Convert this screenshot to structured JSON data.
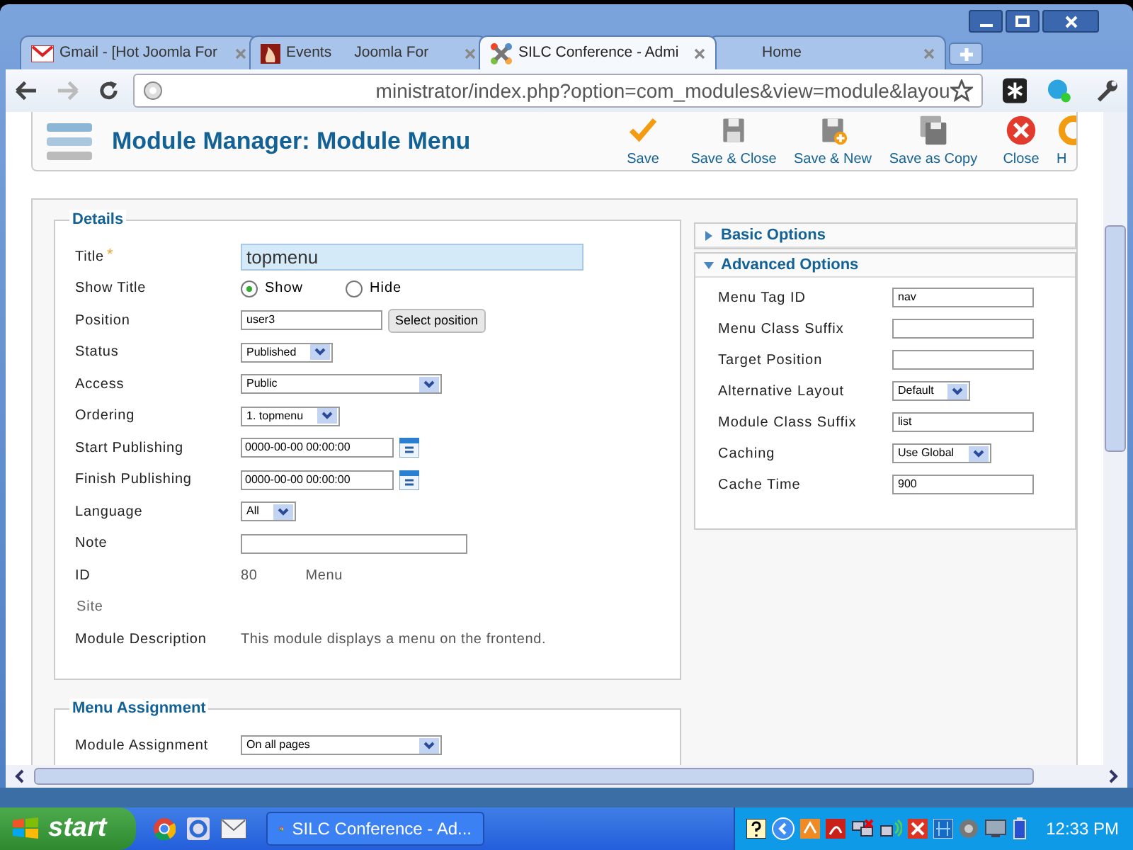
{
  "browser": {
    "tabs": [
      {
        "label": "Gmail - [Hot Joomla For",
        "kind": "gmail",
        "selected": false
      },
      {
        "label": "Events",
        "label_2": "Joomla For",
        "kind": "events",
        "selected": false
      },
      {
        "label": "SILC Conference - Admi",
        "kind": "joomla",
        "selected": true
      },
      {
        "label": "Home",
        "selected": false
      }
    ],
    "address": "ministrator/index.php?option=com_modules&view=module&layou"
  },
  "toolbar": {
    "title": "Module Manager: Module Menu",
    "buttons": [
      {
        "label": "Save",
        "kind": "save"
      },
      {
        "label": "Save & Close",
        "kind": "save_close"
      },
      {
        "label": "Save & New",
        "kind": "save_new"
      },
      {
        "label": "Save as Copy",
        "kind": "save_copy"
      },
      {
        "label": "Close",
        "kind": "close"
      },
      {
        "label": "H",
        "kind": "help"
      }
    ]
  },
  "details": {
    "legend": "Details",
    "fields": [
      {
        "label": "Title",
        "kind": "text",
        "required_mark": "*",
        "focused": true,
        "value": "topmenu"
      },
      {
        "label": "Show Title",
        "kind": "radio",
        "options": [
          {
            "label": "Show",
            "selected": true
          },
          {
            "label": "Hide",
            "selected": false
          }
        ]
      },
      {
        "label": "Position",
        "kind": "text_button",
        "value": "user3",
        "button": "Select position"
      },
      {
        "label": "Status",
        "kind": "select",
        "value": "Published"
      },
      {
        "label": "Access",
        "kind": "select",
        "value": "Public",
        "wide": true
      },
      {
        "label": "Ordering",
        "kind": "select",
        "value": "1. topmenu"
      },
      {
        "label": "Start Publishing",
        "kind": "date",
        "value": "0000-00-00 00:00:00"
      },
      {
        "label": "Finish Publishing",
        "kind": "date",
        "value": "0000-00-00 00:00:00"
      },
      {
        "label": "Language",
        "kind": "select",
        "value": "All"
      },
      {
        "label": "Note",
        "kind": "text"
      },
      {
        "label": "ID",
        "kind": "static",
        "value": "80",
        "value_2": "Menu"
      },
      {
        "label": "Site",
        "kind": "note"
      },
      {
        "label": "Module Description",
        "kind": "static",
        "value": "This module displays a menu on the frontend."
      }
    ]
  },
  "options": {
    "panels": [
      {
        "title": "Basic Options",
        "expanded": false
      },
      {
        "title": "Advanced Options",
        "expanded": true,
        "fields": [
          {
            "label": "Menu Tag ID",
            "kind": "text",
            "value": "nav"
          },
          {
            "label": "Menu Class Suffix",
            "kind": "text"
          },
          {
            "label": "Target Position",
            "kind": "text"
          },
          {
            "label": "Alternative Layout",
            "kind": "select",
            "value": "Default"
          },
          {
            "label": "Module Class Suffix",
            "kind": "text",
            "value": "list"
          },
          {
            "label": "Caching",
            "kind": "select",
            "value": "Use Global"
          },
          {
            "label": "Cache Time",
            "kind": "text",
            "value": "900"
          }
        ]
      }
    ]
  },
  "menu_assignment": {
    "legend": "Menu Assignment",
    "fields": [
      {
        "label": "Module Assignment",
        "kind": "select",
        "value": "On all pages",
        "wide": true
      }
    ]
  },
  "taskbar": {
    "start": "start",
    "tasks": [
      {
        "label": "SILC Conference - Ad..."
      }
    ],
    "clock": "12:33 PM"
  }
}
